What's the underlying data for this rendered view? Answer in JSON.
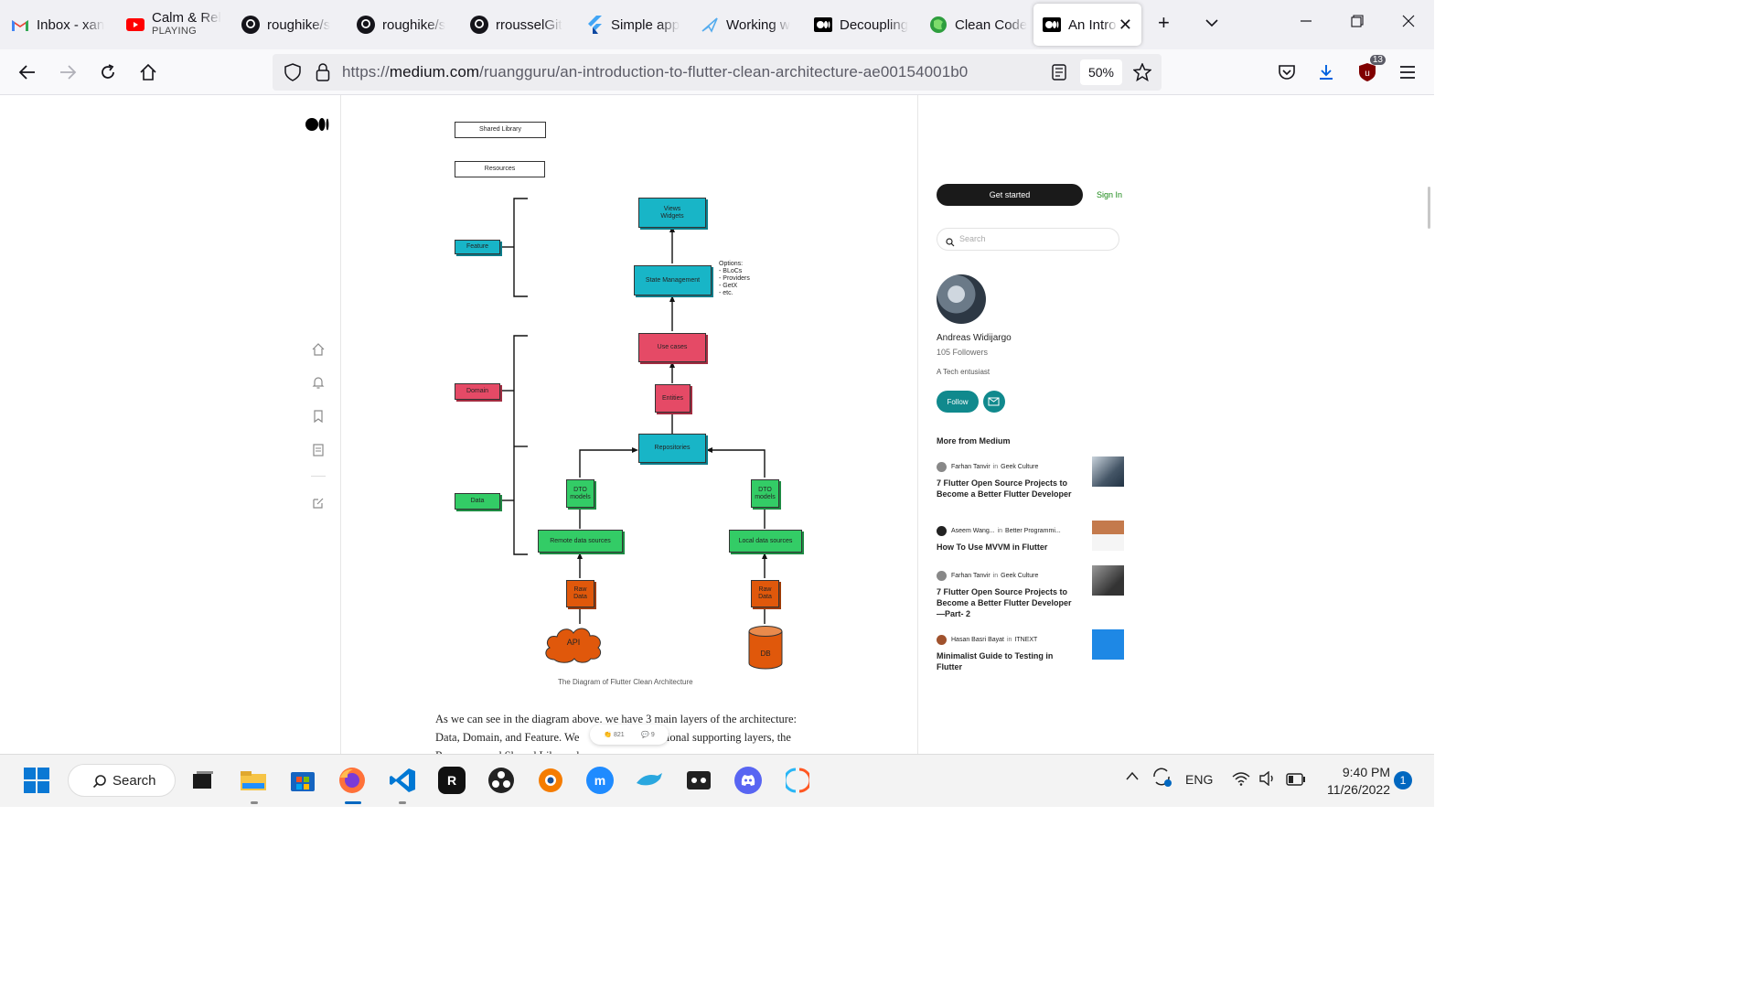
{
  "browser": {
    "tabs": [
      {
        "title": "Inbox - xan",
        "icon": "gmail-icon"
      },
      {
        "title": "Calm & Rel",
        "subtitle": "PLAYING",
        "icon": "youtube-icon"
      },
      {
        "title": "roughike/s",
        "icon": "github-icon"
      },
      {
        "title": "roughike/s",
        "icon": "github-icon"
      },
      {
        "title": "rrousselGit",
        "icon": "github-icon"
      },
      {
        "title": "Simple app",
        "icon": "flutter-icon"
      },
      {
        "title": "Working w",
        "icon": "bird-icon"
      },
      {
        "title": "Decoupling",
        "icon": "medium-icon"
      },
      {
        "title": "Clean Code",
        "icon": "globe-icon"
      },
      {
        "title": "An Intro",
        "icon": "medium-icon",
        "active": true
      }
    ],
    "url_prefix": "https://",
    "url_domain": "medium.com",
    "url_path": "/ruangguru/an-introduction-to-flutter-clean-architecture-ae00154001b0",
    "zoom": "50%",
    "extension_badge": "13"
  },
  "sidebar": {
    "logo": "medium-logo"
  },
  "diagram": {
    "shared_library": "Shared Library",
    "resources": "Resources",
    "feature": "Feature",
    "domain": "Domain",
    "data": "Data",
    "views_widgets": "Views\nWidgets",
    "state_management": "State Management",
    "options": "Options:\n- BLoCs\n- Providers\n- GetX\n- etc.",
    "use_cases": "Use cases",
    "entities": "Entities",
    "repositories": "Repositories",
    "dto_left": "DTO\nmodels",
    "dto_right": "DTO\nmodels",
    "remote_sources": "Remote data sources",
    "local_sources": "Local data sources",
    "raw_left": "Raw\nData",
    "raw_right": "Raw\nData",
    "api": "API",
    "db": "DB",
    "caption": "The Diagram of Flutter Clean Architecture",
    "colors": {
      "teal": "#18b5c7",
      "red": "#e54a66",
      "green": "#33cc66",
      "orange": "#e0580b"
    }
  },
  "article": {
    "paragraph_line1": "As we can see in the diagram above. we have 3 main layers of the architecture:",
    "paragraph_line2a": "Data, Domain, and Feature. We",
    "paragraph_line2b": "tional supporting layers, the",
    "paragraph_line3": "Resources and Shared Library layers.",
    "claps": "821",
    "comments": "9"
  },
  "right": {
    "get_started": "Get started",
    "sign_in": "Sign In",
    "search_placeholder": "Search",
    "author_name": "Andreas Widijargo",
    "followers": "105 Followers",
    "bio": "A Tech entusiast",
    "follow": "Follow",
    "more_heading": "More from Medium",
    "recs": [
      {
        "author": "Farhan Tanvir",
        "in": "in",
        "pub": "Geek Culture",
        "title": "7 Flutter Open Source Projects to Become a Better Flutter Developer"
      },
      {
        "author": "Aseem Wang...",
        "in": "in",
        "pub": "Better Programmi...",
        "title": "How To Use MVVM in Flutter"
      },
      {
        "author": "Farhan Tanvir",
        "in": "in",
        "pub": "Geek Culture",
        "title": "7 Flutter Open Source Projects to Become a Better Flutter Developer—Part- 2"
      },
      {
        "author": "Hasan Basri Bayat",
        "in": "in",
        "pub": "ITNEXT",
        "title": "Minimalist Guide to Testing in Flutter"
      }
    ]
  },
  "taskbar": {
    "search": "Search",
    "lang": "ENG",
    "time": "9:40 PM",
    "date": "11/26/2022",
    "notifications": "1"
  }
}
